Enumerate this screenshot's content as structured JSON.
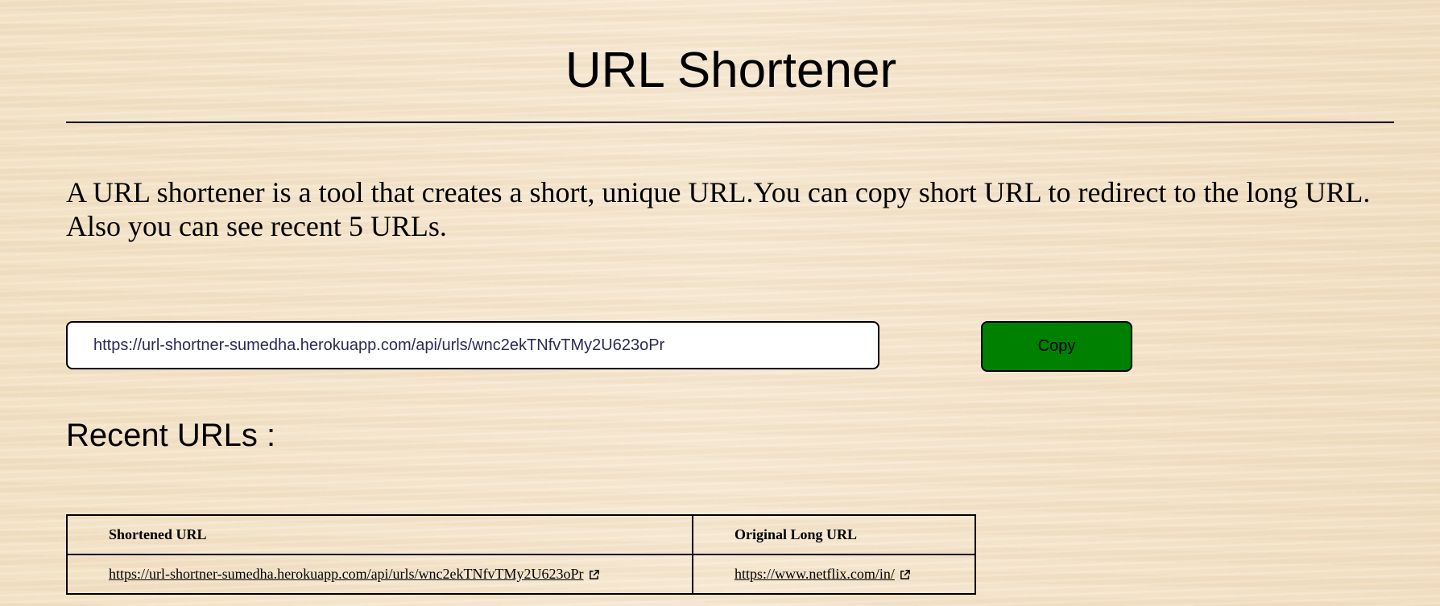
{
  "page": {
    "title": "URL Shortener",
    "description": "A URL shortener is a tool that creates a short, unique URL.You can copy short URL to redirect to the long URL. Also you can see recent 5 URLs."
  },
  "shortener": {
    "input_value": "https://url-shortner-sumedha.herokuapp.com/api/urls/wnc2ekTNfvTMy2U623oPr",
    "copy_label": "Copy",
    "copy_button_color": "#008000"
  },
  "recent": {
    "heading": "Recent URLs :",
    "columns": [
      "Shortened URL",
      "Original Long URL"
    ],
    "rows": [
      {
        "short_url": "https://url-shortner-sumedha.herokuapp.com/api/urls/wnc2ekTNfvTMy2U623oPr",
        "long_url": "https://www.netflix.com/in/"
      }
    ],
    "link_icon": "external-link-icon"
  },
  "colors": {
    "background": "#f5e6cf",
    "text": "#000000",
    "input_text": "#2a2a55"
  }
}
